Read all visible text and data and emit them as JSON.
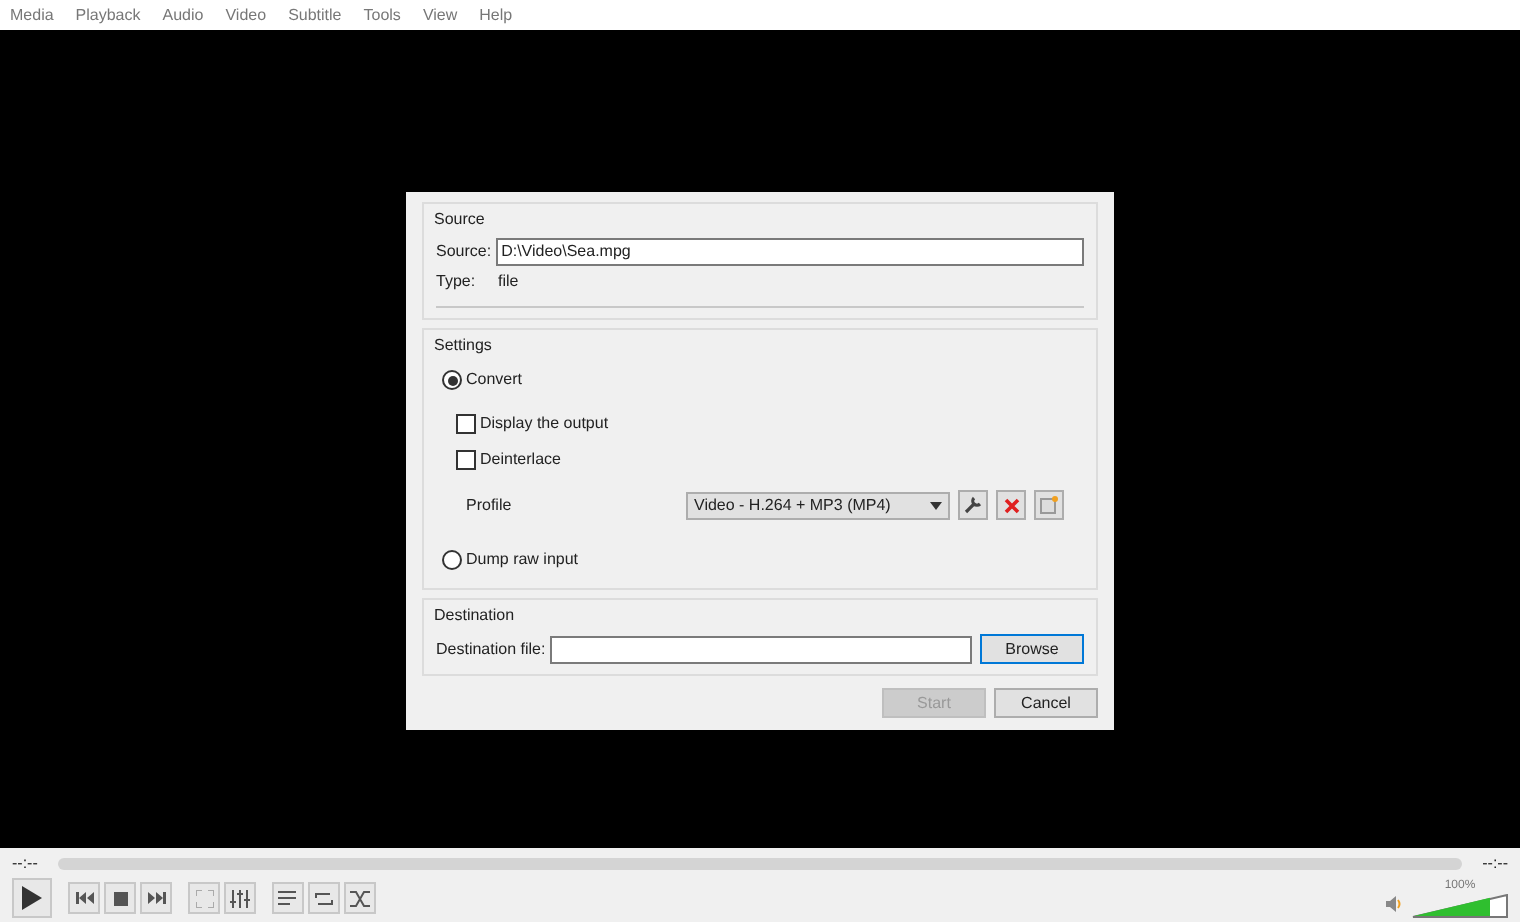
{
  "menu": [
    "Media",
    "Playback",
    "Audio",
    "Video",
    "Subtitle",
    "Tools",
    "View",
    "Help"
  ],
  "dialog": {
    "source": {
      "title": "Source",
      "source_label": "Source:",
      "source_value": "D:\\Video\\Sea.mpg",
      "type_label": "Type:",
      "type_value": "file"
    },
    "settings": {
      "title": "Settings",
      "modes": [
        {
          "label": "Convert",
          "selected": true
        },
        {
          "label": "Dump raw input",
          "selected": false
        }
      ],
      "options": [
        {
          "label": "Display the output",
          "checked": false
        },
        {
          "label": "Deinterlace",
          "checked": false
        }
      ],
      "profile_label": "Profile",
      "profile_value": "Video - H.264 + MP3 (MP4)"
    },
    "destination": {
      "title": "Destination",
      "label": "Destination file:",
      "browse": "Browse"
    },
    "buttons": [
      {
        "label": "Start",
        "disabled": true
      },
      {
        "label": "Cancel",
        "disabled": false
      }
    ]
  },
  "player": {
    "elapsed": "--:--",
    "remaining": "--:--",
    "volume_reading": "100%",
    "volume": {
      "level": 0.83
    }
  }
}
